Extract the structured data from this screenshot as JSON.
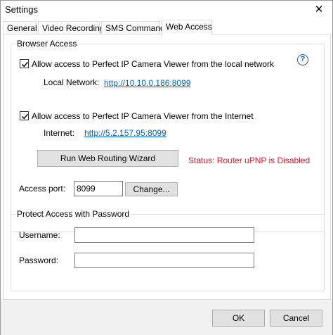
{
  "window": {
    "title": "Settings",
    "close_glyph": "✕"
  },
  "tabs": [
    {
      "label": "General"
    },
    {
      "label": "Video Recording"
    },
    {
      "label": "SMS Commands"
    },
    {
      "label": "Web Access"
    }
  ],
  "active_tab": "Web Access",
  "browser_access": {
    "group_label": "Browser Access",
    "local": {
      "checkbox_label": "Allow access to Perfect IP Camera Viewer from the local network",
      "checked": true,
      "field_label": "Local Network:",
      "url": "http://10.10.0.186:8099"
    },
    "internet": {
      "checkbox_label": "Allow access to Perfect IP Camera Viewer from the Internet",
      "checked": true,
      "field_label": "Internet:",
      "url": "http://5.2.157.95:8099"
    },
    "wizard_button": "Run Web Routing Wizard",
    "status": "Status: Router uPNP is Disabled",
    "status_color": "#e81123",
    "port_label": "Access port:",
    "port_value": "8099",
    "change_button": "Change..."
  },
  "protect": {
    "group_label": "Protect Access with Password",
    "username_label": "Username:",
    "username_value": "",
    "password_label": "Password:",
    "password_value": ""
  },
  "footer": {
    "ok_label": "OK",
    "cancel_label": "Cancel"
  },
  "help_glyph": "?"
}
